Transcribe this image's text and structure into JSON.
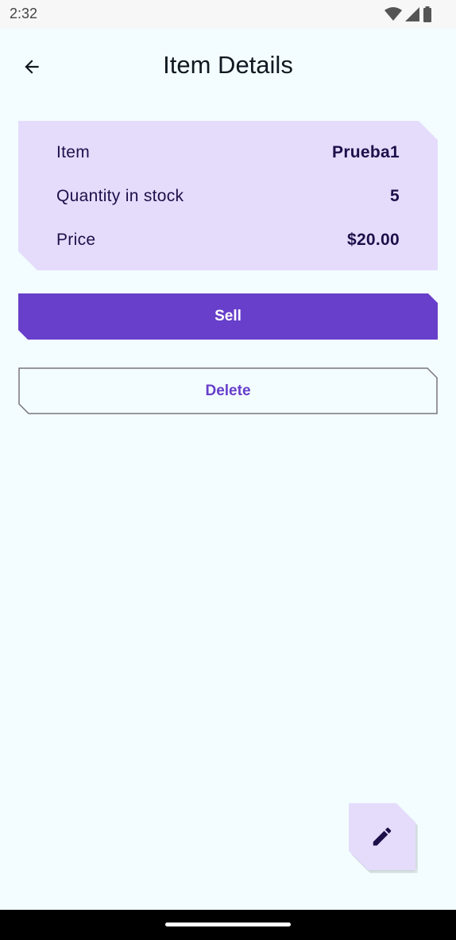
{
  "status_bar": {
    "time": "2:32",
    "icons": [
      "wifi-icon",
      "cellular-signal-icon",
      "battery-icon"
    ]
  },
  "top_bar": {
    "title": "Item Details",
    "back_icon": "arrow-back-icon"
  },
  "details": {
    "rows": [
      {
        "label": "Item",
        "value": "Prueba1"
      },
      {
        "label": "Quantity in stock",
        "value": "5"
      },
      {
        "label": "Price",
        "value": "$20.00"
      }
    ]
  },
  "actions": {
    "sell_label": "Sell",
    "delete_label": "Delete"
  },
  "fab": {
    "icon": "edit-pencil-icon"
  },
  "colors": {
    "background": "#F3FDFF",
    "card": "#E5DCFC",
    "primary": "#673FCA",
    "on_card_text": "#1E0F4A",
    "outline": "#79747E"
  }
}
